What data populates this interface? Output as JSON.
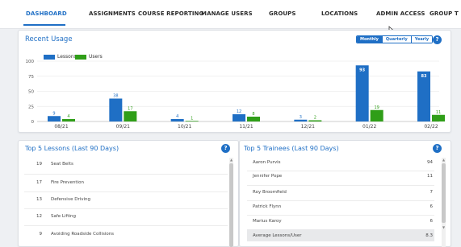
{
  "nav": {
    "tabs": [
      "DASHBOARD",
      "ASSIGNMENTS",
      "COURSE REPORTING",
      "MANAGE USERS",
      "GROUPS",
      "LOCATIONS",
      "ADMIN ACCESS",
      "GROUP T"
    ],
    "active": "DASHBOARD"
  },
  "usage": {
    "title": "Recent Usage",
    "periods": [
      "Monthly",
      "Quarterly",
      "Yearly"
    ],
    "active_period": "Monthly",
    "help": "?"
  },
  "chart_data": {
    "type": "bar",
    "categories": [
      "08/21",
      "09/21",
      "10/21",
      "11/21",
      "12/21",
      "01/22",
      "02/22"
    ],
    "series": [
      {
        "name": "Lessons",
        "color": "#1f6fc5",
        "values": [
          9,
          38,
          4,
          12,
          3,
          93,
          83
        ]
      },
      {
        "name": "Users",
        "color": "#2f9e18",
        "values": [
          4,
          17,
          1,
          8,
          2,
          19,
          11
        ]
      }
    ],
    "value_labels": {
      "Lessons": [
        "9",
        "38",
        "4",
        "12",
        "3",
        "93",
        "83"
      ],
      "Users": [
        "4",
        "17",
        "1",
        "8",
        "2",
        "19",
        "11"
      ]
    },
    "ylim": [
      0,
      100
    ],
    "yticks": [
      "0",
      "25",
      "50",
      "75",
      "100"
    ],
    "grid": true,
    "legend": "top-left"
  },
  "lessons": {
    "title": "Top 5 Lessons (Last 90 Days)",
    "help": "?",
    "items": [
      {
        "count": "19",
        "name": "Seat Belts"
      },
      {
        "count": "17",
        "name": "Fire Prevention"
      },
      {
        "count": "13",
        "name": "Defensive Driving"
      },
      {
        "count": "12",
        "name": "Safe Lifting"
      },
      {
        "count": "9",
        "name": "Avoiding Roadside Collisions"
      }
    ]
  },
  "trainees": {
    "title": "Top 5 Trainees (Last 90 Days)",
    "help": "?",
    "items": [
      {
        "name": "Aaron Purvis",
        "value": "94"
      },
      {
        "name": "Jennifer Pope",
        "value": "11"
      },
      {
        "name": "Roy Broomfield",
        "value": "7"
      },
      {
        "name": "Patrick Flynn",
        "value": "6"
      },
      {
        "name": "Marius Karoy",
        "value": "6"
      }
    ],
    "average_label": "Average Lessons/User",
    "average_value": "8.3"
  }
}
